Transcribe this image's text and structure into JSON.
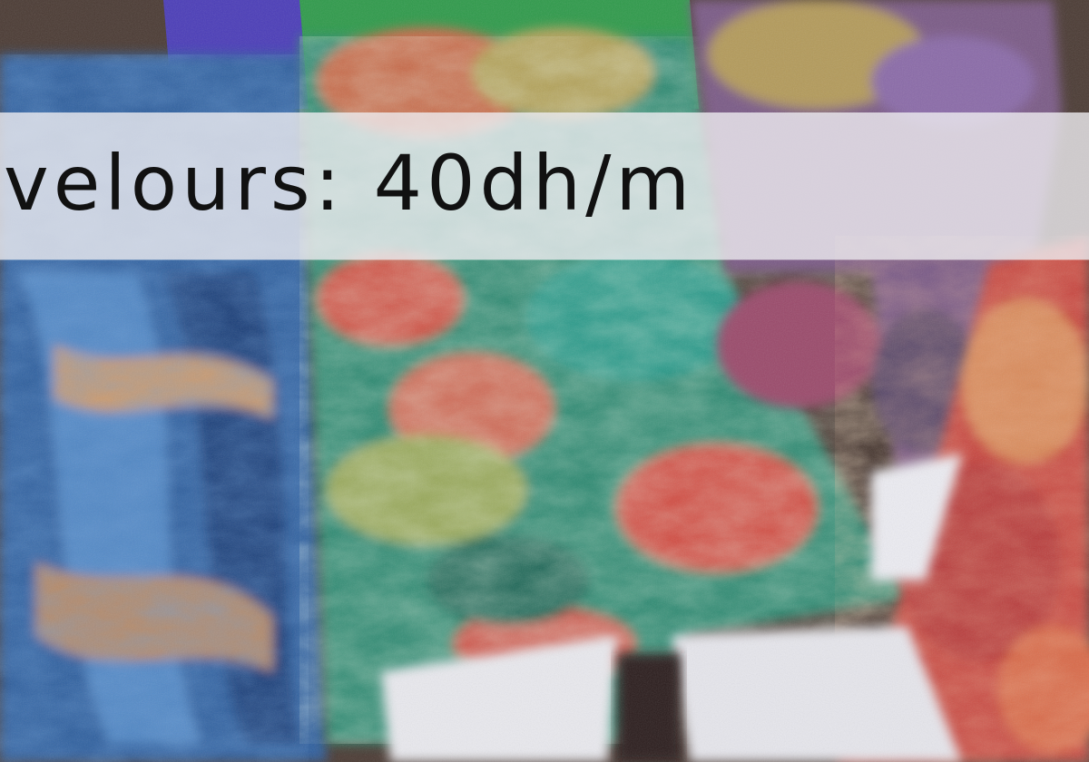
{
  "banner": {
    "text": "velours: 40dh/m",
    "background": "#eeecf0",
    "text_color": "#111111"
  },
  "photo": {
    "palette": {
      "left_fabric_blue": "#2f5e9e",
      "center_fabric_green": "#2f8a72",
      "center_fabric_coral": "#d0574a",
      "right_fabric_purple": "#7a5a86",
      "right_fabric_red": "#c8473f",
      "white_cloth": "#eaeaee",
      "green_top": "#2e9a4a",
      "purple_top": "#4a3cb8"
    }
  }
}
